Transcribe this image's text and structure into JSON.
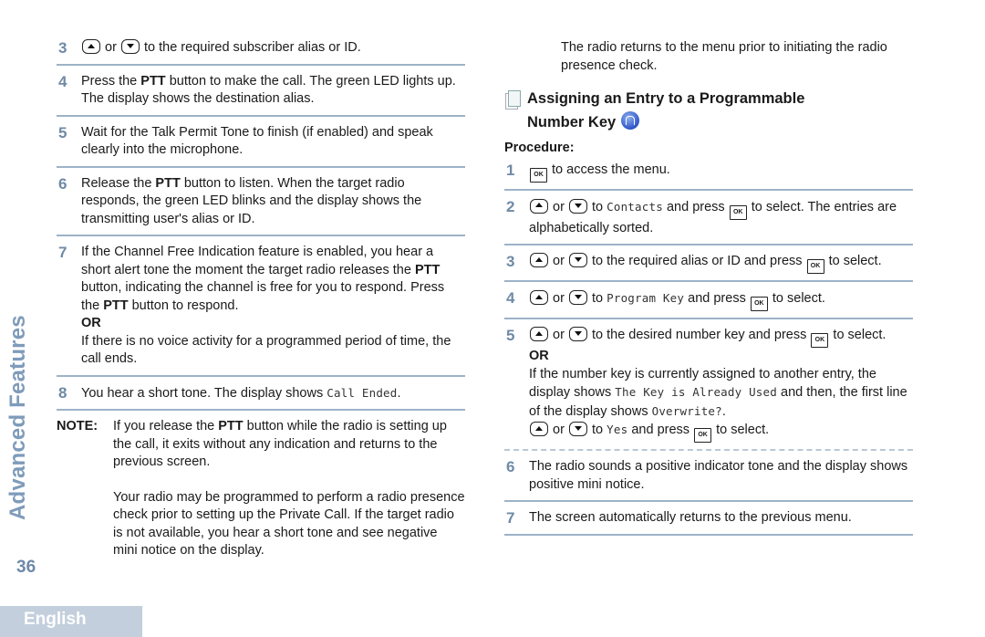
{
  "sidebar": {
    "section_title": "Advanced Features",
    "page_number": "36",
    "language_tab": "English"
  },
  "left": {
    "steps": [
      {
        "num": "3",
        "parts": [
          "or",
          "to the required subscriber alias or ID."
        ]
      },
      {
        "num": "4",
        "pre": "Press the ",
        "bold": "PTT",
        "post": " button to make the call. The green LED lights up. The display shows the destination alias."
      },
      {
        "num": "5",
        "text": "Wait for the Talk Permit Tone to finish (if enabled) and speak clearly into the microphone."
      },
      {
        "num": "6",
        "pre": "Release the ",
        "bold": "PTT",
        "post": " button to listen. When the target radio responds, the green LED blinks and the display shows the transmitting user's alias or ID."
      },
      {
        "num": "7",
        "pre": "If the Channel Free Indication feature is enabled, you hear a short alert tone the moment the target radio releases the ",
        "bold": "PTT",
        "mid": " button, indicating the channel is free for you to respond. Press the ",
        "bold2": "PTT",
        "post": " button to respond.",
        "or": "OR",
        "after": "If there is no voice activity for a programmed period of time, the call ends."
      },
      {
        "num": "8",
        "pre": "You hear a short tone. The display shows ",
        "mono": "Call Ended",
        "post": "."
      }
    ],
    "note": {
      "label": "NOTE:",
      "p1_pre": "If you release the ",
      "p1_bold": "PTT",
      "p1_post": " button while the radio is setting up the call, it exits without any indication and returns to the previous screen.",
      "p2": "Your radio may be programmed to perform a radio presence check prior to setting up the Private Call. If the target radio is not available, you hear a short tone and see negative mini notice on the display."
    }
  },
  "right": {
    "intro": "The radio returns to the menu prior to initiating the radio presence check.",
    "heading_line1": "Assigning an Entry to a Programmable",
    "heading_line2": "Number Key",
    "procedure_label": "Procedure:",
    "steps": [
      {
        "num": "1",
        "text": "to access the menu."
      },
      {
        "num": "2",
        "or": "or",
        "to": "to",
        "mono": "Contacts",
        "mid": "and press",
        "post": "to select. The entries are alphabetically sorted."
      },
      {
        "num": "3",
        "or": "or",
        "mid": "to the required alias or ID and press",
        "post": "to select."
      },
      {
        "num": "4",
        "or": "or",
        "to": "to",
        "mono": "Program Key",
        "mid": "and press",
        "post": "to select."
      },
      {
        "num": "5",
        "or": "or",
        "mid": "to the desired number key and press",
        "post": "to select.",
        "or_label": "OR",
        "alt_pre": "If the number key is currently assigned to another entry, the display shows ",
        "alt_mono1": "The Key is Already Used",
        "alt_mid": " and then, the first line of the display shows ",
        "alt_mono2": "Overwrite?",
        "alt_post": ".",
        "last_to": "to",
        "last_mono": "Yes",
        "last_mid": "and press",
        "last_post": "to select."
      },
      {
        "num": "6",
        "text": "The radio sounds a positive indicator tone and the display shows positive mini notice."
      },
      {
        "num": "7",
        "text": "The screen automatically returns to the previous menu."
      }
    ]
  },
  "icons": {
    "up_key": "up-arrow-key-icon",
    "down_key": "down-arrow-key-icon",
    "ok_key": "menu-ok-key-icon",
    "ok_key_label": "OK"
  }
}
